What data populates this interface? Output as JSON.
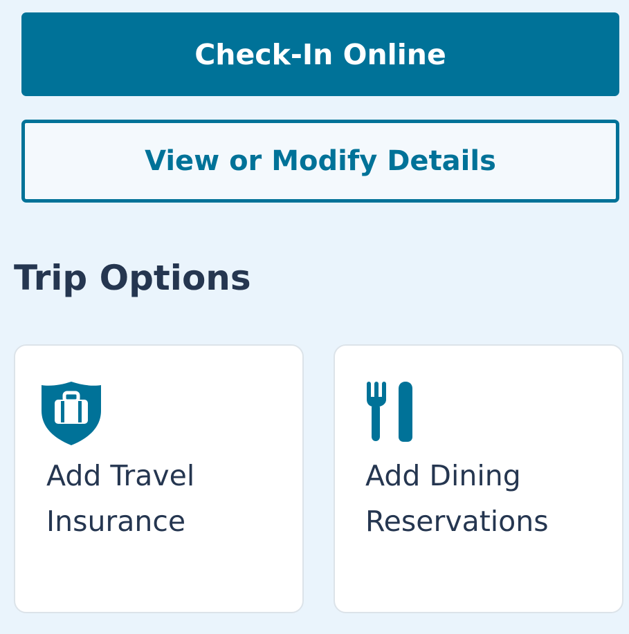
{
  "actions": {
    "check_in_label": "Check-In Online",
    "modify_label": "View or Modify Details"
  },
  "trip_options": {
    "title": "Trip Options",
    "cards": [
      {
        "label": "Add Travel Insurance",
        "icon": "shield-luggage-icon"
      },
      {
        "label": "Add Dining Reservations",
        "icon": "fork-knife-icon"
      }
    ]
  },
  "colors": {
    "background": "#eaf4fc",
    "accent": "#007298",
    "text": "#253650",
    "card": "#ffffff",
    "card_border": "#dce3e9"
  }
}
